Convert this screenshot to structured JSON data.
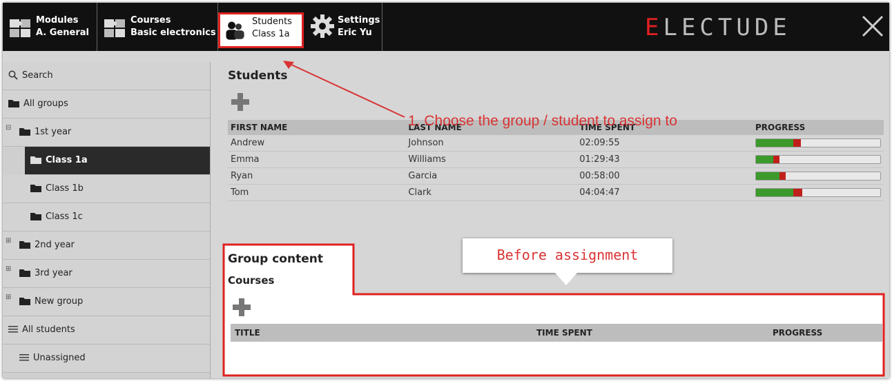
{
  "topbar": {
    "modules": {
      "label": "Modules",
      "value": "A. General",
      "icon": "puzzle-icon"
    },
    "courses": {
      "label": "Courses",
      "value": "Basic electronics",
      "icon": "puzzle-icon"
    },
    "students": {
      "label": "Students",
      "value": "Class 1a",
      "icon": "users-icon"
    },
    "settings": {
      "label": "Settings",
      "value": "Eric Yu",
      "icon": "gear-icon"
    },
    "logo_first": "E",
    "logo_rest": "LECTUDE",
    "close_icon": "close-icon"
  },
  "sidebar": {
    "search": "Search",
    "items": [
      {
        "label": "All groups"
      },
      {
        "label": "1st year"
      },
      {
        "label": "Class 1a"
      },
      {
        "label": "Class 1b"
      },
      {
        "label": "Class 1c"
      },
      {
        "label": "2nd year"
      },
      {
        "label": "3rd year"
      },
      {
        "label": "New group"
      },
      {
        "label": "All students"
      },
      {
        "label": "Unassigned"
      }
    ]
  },
  "students": {
    "title": "Students",
    "columns": [
      "FIRST NAME",
      "LAST NAME",
      "TIME SPENT",
      "PROGRESS"
    ],
    "rows": [
      {
        "first": "Andrew",
        "last": "Johnson",
        "time": "02:09:55",
        "progress_green": 0.3,
        "progress_red": 0.06
      },
      {
        "first": "Emma",
        "last": "Williams",
        "time": "01:29:43",
        "progress_green": 0.14,
        "progress_red": 0.05
      },
      {
        "first": "Ryan",
        "last": "Garcia",
        "time": "00:58:00",
        "progress_green": 0.19,
        "progress_red": 0.05
      },
      {
        "first": "Tom",
        "last": "Clark",
        "time": "04:04:47",
        "progress_green": 0.3,
        "progress_red": 0.07
      }
    ]
  },
  "group_content": {
    "title": "Group content",
    "subtitle": "Courses",
    "columns": [
      "TITLE",
      "TIME SPENT",
      "PROGRESS"
    ]
  },
  "annotations": {
    "step1": "1. Choose the group / student to assign to",
    "callout": "Before assignment"
  },
  "colors": {
    "accent": "#e02020",
    "progress_green": "#3c9a2c",
    "progress_red": "#c0201a"
  }
}
